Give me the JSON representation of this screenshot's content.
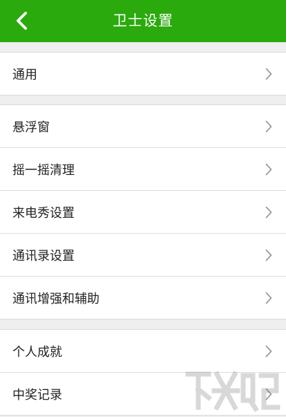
{
  "header": {
    "title": "卫士设置",
    "back_icon": "back-arrow-icon",
    "background": "#2aaa0c"
  },
  "groups": [
    {
      "items": [
        {
          "label": "通用",
          "icon": "chevron-right-icon"
        }
      ]
    },
    {
      "items": [
        {
          "label": "悬浮窗",
          "icon": "chevron-right-icon"
        },
        {
          "label": "摇一摇清理",
          "icon": "chevron-right-icon"
        },
        {
          "label": "来电秀设置",
          "icon": "chevron-right-icon"
        },
        {
          "label": "通讯录设置",
          "icon": "chevron-right-icon"
        },
        {
          "label": "通讯增强和辅助",
          "icon": "chevron-right-icon"
        }
      ]
    },
    {
      "items": [
        {
          "label": "个人成就",
          "icon": "chevron-right-icon"
        },
        {
          "label": "中奖记录",
          "icon": "chevron-right-icon"
        }
      ]
    }
  ]
}
